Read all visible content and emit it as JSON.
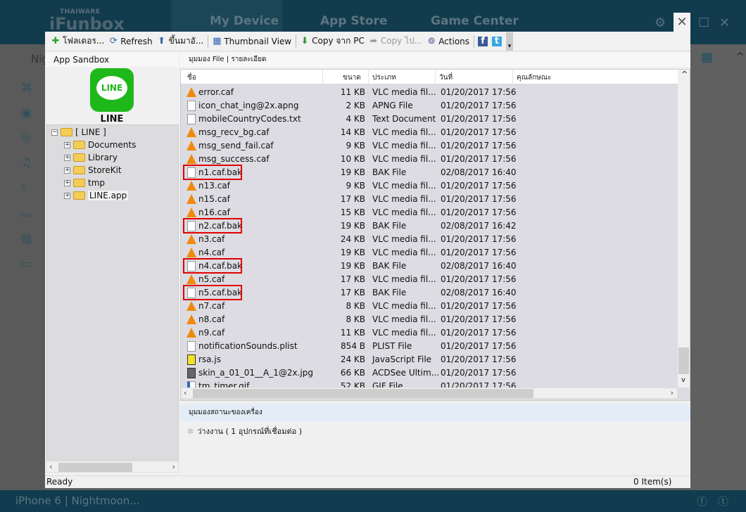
{
  "background": {
    "brand": "iFunbox",
    "brand_sub": "THAIWARE",
    "tabs": [
      "My Device",
      "App Store",
      "Game Center"
    ],
    "device_label": "iPhone 6 | Nightmoon...",
    "side_partial": "Nig"
  },
  "toolbar": {
    "new_folder": "โฟลเดอร...",
    "refresh": "Refresh",
    "up": "ขึ้นมาอั...",
    "thumbnail": "Thumbnail View",
    "copy_from_pc": "Copy จาก PC",
    "copy_to": "Copy ไป...",
    "actions": "Actions"
  },
  "left": {
    "title": "App Sandbox",
    "app_name": "LINE",
    "app_icon_text": "LINE",
    "tree": [
      {
        "label": "[ LINE ]",
        "expanded": true
      },
      {
        "label": "Documents"
      },
      {
        "label": "Library"
      },
      {
        "label": "StoreKit"
      },
      {
        "label": "tmp"
      },
      {
        "label": "LINE.app"
      }
    ]
  },
  "right": {
    "title": "มุมมอง File",
    "title_sep": "|",
    "title2": "รายละเอียด",
    "columns": [
      "ชื่อ",
      "ขนาด",
      "ประเภท",
      "วันที่",
      "คุณลักษณะ"
    ],
    "files": [
      {
        "name": "error.caf",
        "size": "11 KB",
        "type": "VLC media fil...",
        "date": "01/20/2017  17:56",
        "icon": "vlc"
      },
      {
        "name": "icon_chat_ing@2x.apng",
        "size": "2 KB",
        "type": "APNG File",
        "date": "01/20/2017  17:56",
        "icon": "doc"
      },
      {
        "name": "mobileCountryCodes.txt",
        "size": "4 KB",
        "type": "Text Document",
        "date": "01/20/2017  17:56",
        "icon": "doc"
      },
      {
        "name": "msg_recv_bg.caf",
        "size": "14 KB",
        "type": "VLC media fil...",
        "date": "01/20/2017  17:56",
        "icon": "vlc"
      },
      {
        "name": "msg_send_fail.caf",
        "size": "9 KB",
        "type": "VLC media fil...",
        "date": "01/20/2017  17:56",
        "icon": "vlc"
      },
      {
        "name": "msg_success.caf",
        "size": "10 KB",
        "type": "VLC media fil...",
        "date": "01/20/2017  17:56",
        "icon": "vlc"
      },
      {
        "name": "n1.caf.bak",
        "size": "19 KB",
        "type": "BAK File",
        "date": "02/08/2017  16:40",
        "icon": "doc",
        "highlight": true
      },
      {
        "name": "n13.caf",
        "size": "9 KB",
        "type": "VLC media fil...",
        "date": "01/20/2017  17:56",
        "icon": "vlc"
      },
      {
        "name": "n15.caf",
        "size": "17 KB",
        "type": "VLC media fil...",
        "date": "01/20/2017  17:56",
        "icon": "vlc"
      },
      {
        "name": "n16.caf",
        "size": "15 KB",
        "type": "VLC media fil...",
        "date": "01/20/2017  17:56",
        "icon": "vlc"
      },
      {
        "name": "n2.caf.bak",
        "size": "19 KB",
        "type": "BAK File",
        "date": "02/08/2017  16:42",
        "icon": "doc",
        "highlight": true
      },
      {
        "name": "n3.caf",
        "size": "24 KB",
        "type": "VLC media fil...",
        "date": "01/20/2017  17:56",
        "icon": "vlc"
      },
      {
        "name": "n4.caf",
        "size": "19 KB",
        "type": "VLC media fil...",
        "date": "01/20/2017  17:56",
        "icon": "vlc"
      },
      {
        "name": "n4.caf.bak",
        "size": "19 KB",
        "type": "BAK File",
        "date": "02/08/2017  16:40",
        "icon": "doc",
        "highlight": true
      },
      {
        "name": "n5.caf",
        "size": "17 KB",
        "type": "VLC media fil...",
        "date": "01/20/2017  17:56",
        "icon": "vlc"
      },
      {
        "name": "n5.caf.bak",
        "size": "17 KB",
        "type": "BAK File",
        "date": "02/08/2017  16:40",
        "icon": "doc",
        "highlight": true
      },
      {
        "name": "n7.caf",
        "size": "8 KB",
        "type": "VLC media fil...",
        "date": "01/20/2017  17:56",
        "icon": "vlc"
      },
      {
        "name": "n8.caf",
        "size": "8 KB",
        "type": "VLC media fil...",
        "date": "01/20/2017  17:56",
        "icon": "vlc"
      },
      {
        "name": "n9.caf",
        "size": "11 KB",
        "type": "VLC media fil...",
        "date": "01/20/2017  17:56",
        "icon": "vlc"
      },
      {
        "name": "notificationSounds.plist",
        "size": "854 B",
        "type": "PLIST File",
        "date": "01/20/2017  17:56",
        "icon": "doc"
      },
      {
        "name": "rsa.js",
        "size": "24 KB",
        "type": "JavaScript File",
        "date": "01/20/2017  17:56",
        "icon": "js"
      },
      {
        "name": "skin_a_01_01__A_1@2x.jpg",
        "size": "66 KB",
        "type": "ACDSee Ultim...",
        "date": "01/20/2017  17:56",
        "icon": "jpg"
      },
      {
        "name": "tm_timer.gif",
        "size": "52 KB",
        "type": "GIF File",
        "date": "01/20/2017  17:56",
        "icon": "gif"
      }
    ],
    "status_title": "มุมมองสถานะของเครื่อง",
    "status_text": "ว่างงาน ( 1 อุปกรณ์ที่เชื่อมต่อ )"
  },
  "statusbar": {
    "left": "Ready",
    "right": "0 Item(s)"
  },
  "colors": {
    "highlight": "#e00000",
    "line_green": "#1fb81b",
    "app_bar": "#123c4e"
  }
}
